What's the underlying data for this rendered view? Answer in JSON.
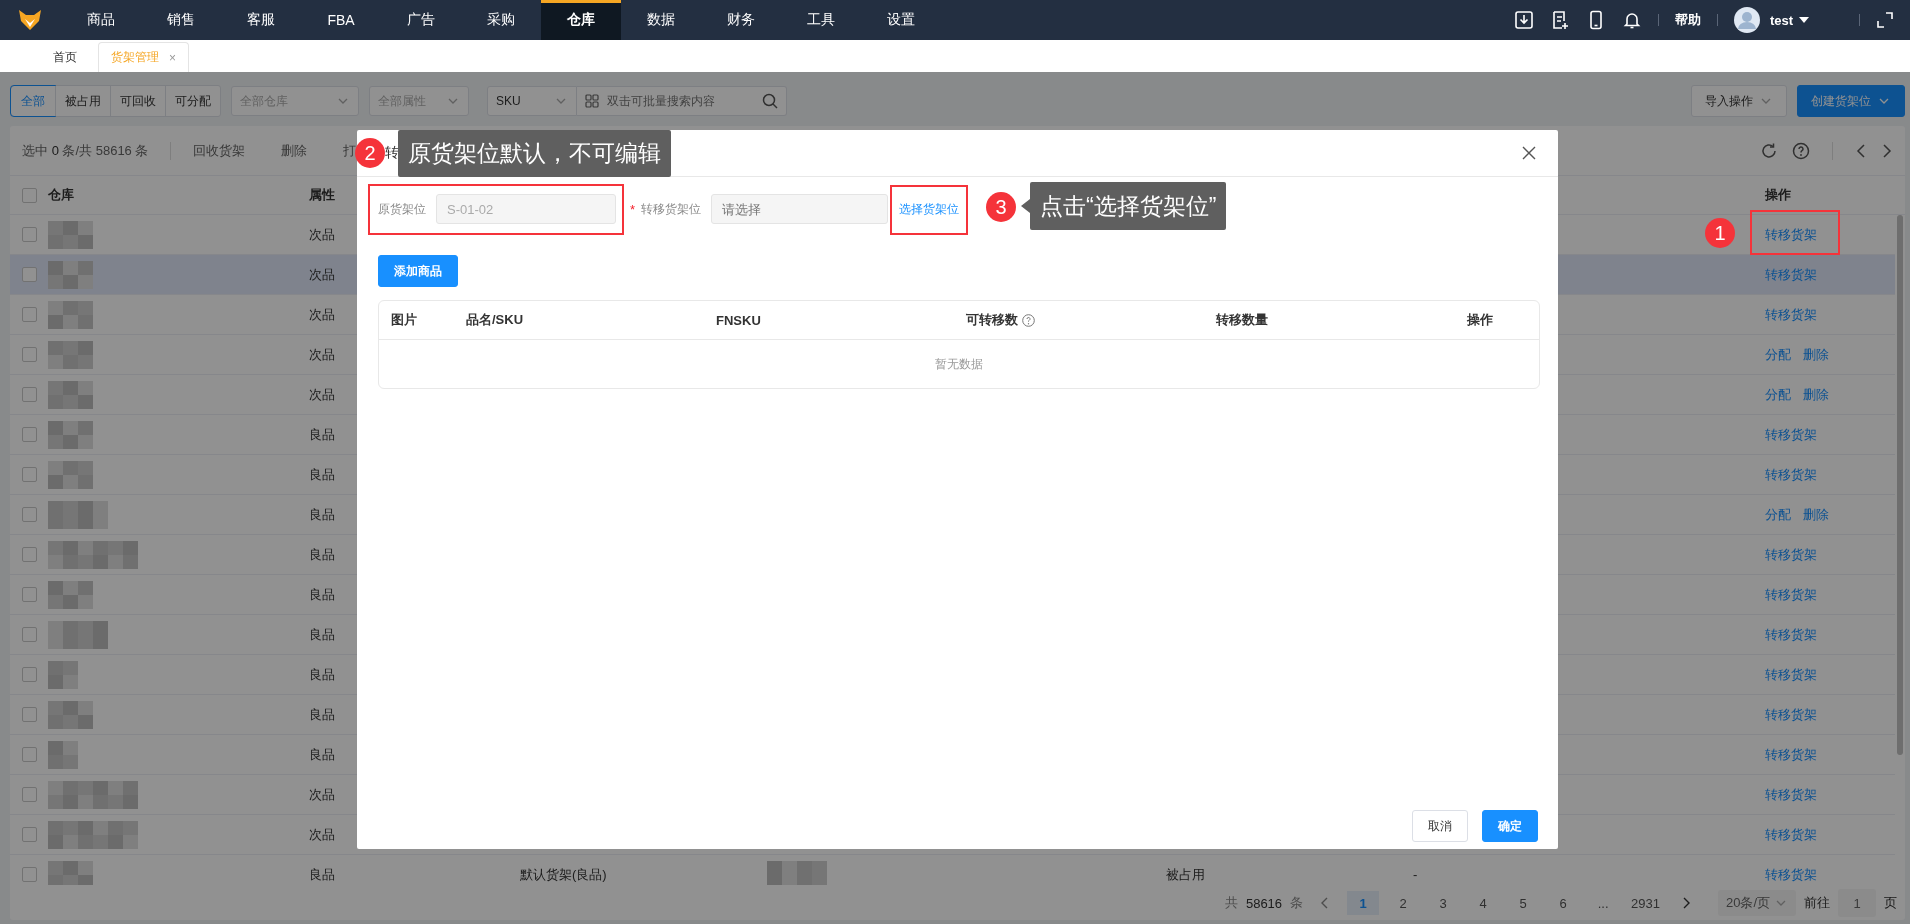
{
  "top_nav": {
    "items": [
      {
        "label": "商品",
        "selected": false
      },
      {
        "label": "销售",
        "selected": false
      },
      {
        "label": "客服",
        "selected": false
      },
      {
        "label": "FBA",
        "selected": false
      },
      {
        "label": "广告",
        "selected": false
      },
      {
        "label": "采购",
        "selected": false
      },
      {
        "label": "仓库",
        "selected": true
      },
      {
        "label": "数据",
        "selected": false
      },
      {
        "label": "财务",
        "selected": false
      },
      {
        "label": "工具",
        "selected": false
      },
      {
        "label": "设置",
        "selected": false
      }
    ],
    "help": "帮助",
    "user": "test"
  },
  "page_tabs": [
    {
      "label": "首页",
      "selected": false
    },
    {
      "label": "货架管理",
      "selected": true,
      "close": "×"
    }
  ],
  "filters": {
    "status_tabs": [
      {
        "label": "全部",
        "selected": true
      },
      {
        "label": "被占用",
        "selected": false
      },
      {
        "label": "可回收",
        "selected": false
      },
      {
        "label": "可分配",
        "selected": false
      }
    ],
    "warehouse_select": {
      "placeholder": "全部仓库"
    },
    "attribute_select": {
      "placeholder": "全部属性"
    },
    "search_type": "SKU",
    "search": {
      "placeholder": "双击可批量搜索内容"
    },
    "import_button": "导入操作",
    "create_button": "创建货架位"
  },
  "table": {
    "select_all_checked": false,
    "summary": "选中 **0** 条/共 58616 条",
    "toolbar_actions": [
      "回收货架",
      "删除",
      "打"
    ],
    "columns": {
      "warehouse": "仓库",
      "attribute": "属性",
      "actions": "操作"
    },
    "rows": [
      {
        "checked": false,
        "highlighted": false,
        "attribute": "次品",
        "actions": [
          "转移货架"
        ]
      },
      {
        "checked": false,
        "highlighted": true,
        "attribute": "次品",
        "actions": [
          "转移货架"
        ]
      },
      {
        "checked": false,
        "highlighted": false,
        "attribute": "次品",
        "actions": [
          "转移货架"
        ]
      },
      {
        "checked": false,
        "highlighted": false,
        "attribute": "次品",
        "actions": [
          "分配",
          "删除"
        ]
      },
      {
        "checked": false,
        "highlighted": false,
        "attribute": "次品",
        "actions": [
          "分配",
          "删除"
        ]
      },
      {
        "checked": false,
        "highlighted": false,
        "attribute": "良品",
        "actions": [
          "转移货架"
        ]
      },
      {
        "checked": false,
        "highlighted": false,
        "attribute": "良品",
        "actions": [
          "转移货架"
        ]
      },
      {
        "checked": false,
        "highlighted": false,
        "attribute": "良品",
        "actions": [
          "分配",
          "删除"
        ]
      },
      {
        "checked": false,
        "highlighted": false,
        "attribute": "良品",
        "actions": [
          "转移货架"
        ]
      },
      {
        "checked": false,
        "highlighted": false,
        "attribute": "良品",
        "actions": [
          "转移货架"
        ]
      },
      {
        "checked": false,
        "highlighted": false,
        "attribute": "良品",
        "actions": [
          "转移货架"
        ]
      },
      {
        "checked": false,
        "highlighted": false,
        "attribute": "良品",
        "actions": [
          "转移货架"
        ]
      },
      {
        "checked": false,
        "highlighted": false,
        "attribute": "良品",
        "actions": [
          "转移货架"
        ]
      },
      {
        "checked": false,
        "highlighted": false,
        "attribute": "良品",
        "actions": [
          "转移货架"
        ]
      },
      {
        "checked": false,
        "highlighted": false,
        "attribute": "次品",
        "actions": [
          "转移货架"
        ]
      },
      {
        "checked": false,
        "highlighted": false,
        "attribute": "次品",
        "actions": [
          "转移货架"
        ]
      },
      {
        "checked": false,
        "highlighted": false,
        "attribute": "良品",
        "column_3": "默认货架(良品)",
        "column_5": "被占用",
        "column_6": "-",
        "actions": [
          "转移货架"
        ]
      }
    ]
  },
  "pagination": {
    "total_prefix": "共",
    "total": "58616",
    "total_suffix": "条",
    "pages": [
      {
        "label": "1",
        "selected": true
      },
      {
        "label": "2",
        "selected": false
      },
      {
        "label": "3",
        "selected": false
      },
      {
        "label": "4",
        "selected": false
      },
      {
        "label": "5",
        "selected": false
      },
      {
        "label": "6",
        "selected": false
      },
      {
        "label": "...",
        "selected": false
      },
      {
        "label": "2931",
        "selected": false
      }
    ],
    "page_size": "20条/页",
    "goto_label": "前往",
    "goto_value": "1",
    "goto_suffix": "页"
  },
  "modal": {
    "title": "转",
    "source_label": "原货架位",
    "source_value": "S-01-02",
    "required_mark": "*",
    "target_label": "转移货架位",
    "target_placeholder": "请选择",
    "choose_link": "选择货架位",
    "add_button": "添加商品",
    "columns": [
      {
        "label": "图片",
        "help": false
      },
      {
        "label": "品名/SKU",
        "help": false
      },
      {
        "label": "FNSKU",
        "help": false
      },
      {
        "label": "可转移数",
        "help": true
      },
      {
        "label": "转移数量",
        "help": false
      },
      {
        "label": "操作",
        "help": false
      }
    ],
    "empty_text": "暂无数据",
    "cancel_button": "取消",
    "ok_button": "确定"
  },
  "annotations": [
    {
      "kind": "marker",
      "number": "1"
    },
    {
      "kind": "callout",
      "number": "2",
      "text": "原货架位默认，不可编辑"
    },
    {
      "kind": "callout",
      "number": "3",
      "text": "点击“选择货架位”",
      "pointer": true
    }
  ]
}
